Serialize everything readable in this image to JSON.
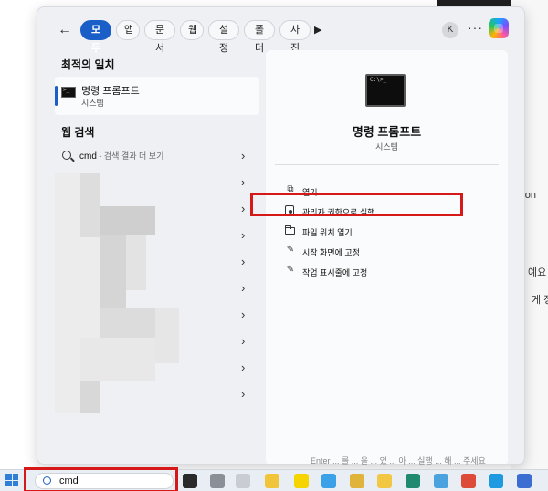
{
  "filters": {
    "back_icon": "back-arrow-icon",
    "chips": [
      "모두",
      "앱",
      "문서",
      "웹",
      "설정",
      "폴더",
      "사진"
    ],
    "active_index": 0,
    "avatar_initial": "K",
    "more_glyph": "···"
  },
  "left": {
    "best_match_heading": "최적의 일치",
    "best_match": {
      "title": "명령 프롬프트",
      "subtitle": "시스템"
    },
    "web_heading": "웹 검색",
    "web_query": "cmd",
    "web_query_suffix": " - 검색 결과 더 보기"
  },
  "right": {
    "app_title": "명령 프롬프트",
    "app_subtitle": "시스템",
    "actions": [
      {
        "label": "열기",
        "icon": "open-external-icon"
      },
      {
        "label": "관리자 권한으로 실행",
        "icon": "admin-shield-icon"
      },
      {
        "label": "파일 위치 열기",
        "icon": "folder-icon"
      },
      {
        "label": "시작 화면에 고정",
        "icon": "pin-icon"
      },
      {
        "label": "작업 표시줄에 고정",
        "icon": "pin-icon"
      }
    ]
  },
  "taskbar": {
    "search_value": "cmd"
  },
  "background": {
    "font_path_fragment": "\\Fon",
    "text_1": "예요",
    "text_2": "게 정",
    "bottom_text": "Enter ... 를 ... 을 ... 있 ... 아 ... 실행 ... 해 ... 주세요"
  },
  "colors": {
    "accent": "#1a5fc8",
    "highlight_red": "#d61818"
  }
}
